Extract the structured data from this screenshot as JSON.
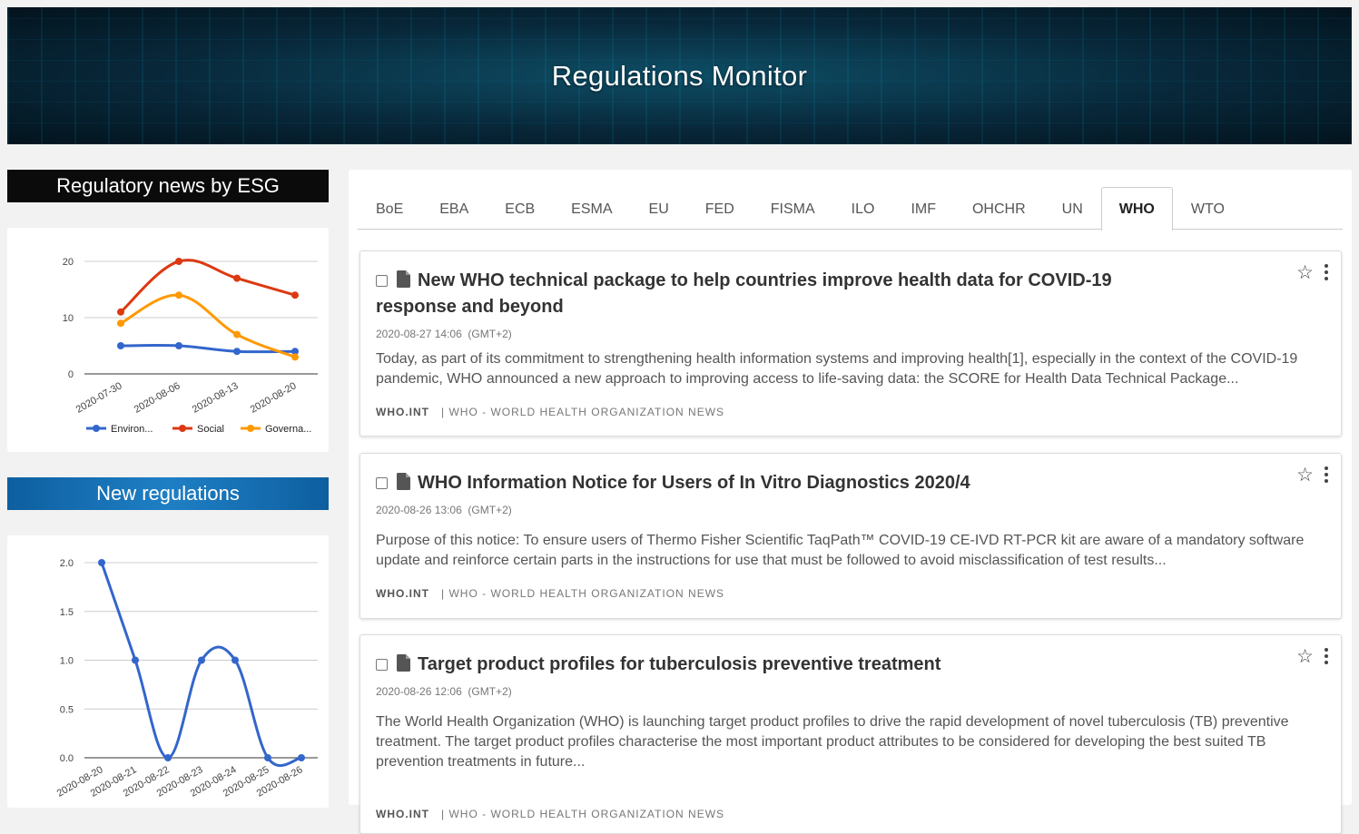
{
  "banner": {
    "title": "Regulations Monitor"
  },
  "sidebar": {
    "esg_title": "Regulatory news by ESG",
    "new_regs_title": "New regulations"
  },
  "tabs": [
    "BoE",
    "EBA",
    "ECB",
    "ESMA",
    "EU",
    "FED",
    "FISMA",
    "ILO",
    "IMF",
    "OHCHR",
    "UN",
    "WHO",
    "WTO"
  ],
  "active_tab": "WHO",
  "articles": [
    {
      "title": "New WHO technical package to help countries improve health data for COVID-19 response and beyond",
      "date": "2020-08-27 14:06",
      "tz": "(GMT+2)",
      "body": "Today, as part of its commitment to strengthening health information systems and improving health[1], especially in the context of the COVID-19 pandemic, WHO announced a new approach to improving access to life-saving data: the SCORE for Health Data Technical Package...",
      "source": "WHO.INT",
      "feed": "| WHO - WORLD HEALTH ORGANIZATION NEWS"
    },
    {
      "title": "WHO Information Notice for Users of In Vitro Diagnostics 2020/4",
      "date": "2020-08-26 13:06",
      "tz": "(GMT+2)",
      "body": "Purpose of this notice: To ensure users of Thermo Fisher Scientific TaqPath™ COVID-19 CE-IVD RT-PCR kit are aware of a mandatory software update and reinforce certain parts in the instructions for use that must be followed to avoid misclassification of test results...",
      "source": "WHO.INT",
      "feed": "| WHO - WORLD HEALTH ORGANIZATION NEWS"
    },
    {
      "title": "Target product profiles for tuberculosis preventive treatment",
      "date": "2020-08-26 12:06",
      "tz": "(GMT+2)",
      "body": "The World Health Organization (WHO) is launching target product profiles to drive the rapid development of novel tuberculosis (TB) preventive treatment. The target product profiles characterise the most important product attributes to be considered for developing the best suited TB prevention treatments in future...",
      "source": "WHO.INT",
      "feed": "| WHO - WORLD HEALTH ORGANIZATION NEWS"
    }
  ],
  "colors": {
    "environment": "#3366cc",
    "social": "#dc3912",
    "governance": "#ff9900",
    "new_regs": "#3366cc"
  },
  "chart_data": [
    {
      "type": "line",
      "x": [
        "2020-07-30",
        "2020-08-06",
        "2020-08-13",
        "2020-08-20"
      ],
      "x_positions": [
        0,
        1,
        2,
        3
      ],
      "series": [
        {
          "name": "Environ...",
          "x": [
            0,
            1,
            2,
            3
          ],
          "values": [
            5,
            5,
            4,
            4
          ]
        },
        {
          "name": "Social",
          "x": [
            0,
            1,
            2,
            3
          ],
          "values": [
            11,
            20,
            17,
            14
          ]
        },
        {
          "name": "Governa...",
          "x": [
            0,
            1,
            2,
            3
          ],
          "values": [
            9,
            14,
            7,
            3
          ]
        }
      ],
      "yticks": [
        0,
        10,
        20
      ],
      "ylim": [
        0,
        20
      ],
      "legend": "bottom",
      "grid": true
    },
    {
      "type": "line",
      "x": [
        "2020-08-20",
        "2020-08-21",
        "2020-08-22",
        "2020-08-23",
        "2020-08-24",
        "2020-08-25",
        "2020-08-26"
      ],
      "series": [
        {
          "values": [
            2,
            1,
            0,
            1,
            1,
            0,
            0
          ]
        }
      ],
      "yticks": [
        "0.0",
        "0.5",
        "1.0",
        "1.5",
        "2.0"
      ],
      "ylim": [
        0,
        2
      ],
      "grid": true
    }
  ]
}
